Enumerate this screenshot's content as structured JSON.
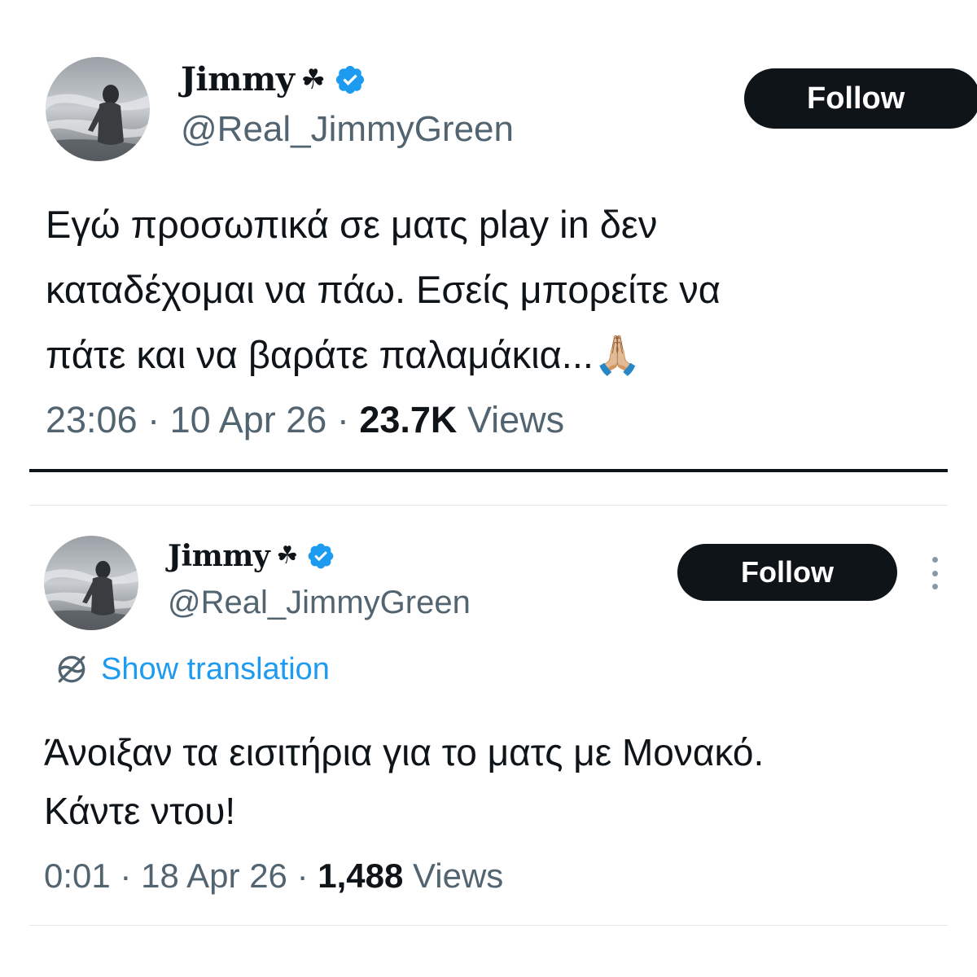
{
  "tweets": [
    {
      "display_name": "Jimmy",
      "name_emoji": "☘",
      "verified": true,
      "handle": "@Real_JimmyGreen",
      "follow_label": "Follow",
      "text": "Εγώ προσωπικά σε ματς play in δεν\nκαταδέχομαι να πάω. Εσείς μπορείτε να\nπάτε και να βαράτε παλαμάκια...🙏🏼",
      "time": "23:06",
      "date": "10 Apr 26",
      "views_count": "23.7K",
      "views_label": "Views"
    },
    {
      "display_name": "Jimmy",
      "name_emoji": "☘",
      "verified": true,
      "handle": "@Real_JimmyGreen",
      "follow_label": "Follow",
      "translate_label": "Show translation",
      "text": "Άνοιξαν τα εισιτήρια για το ματς με Μονακό.\nΚάντε ντου!",
      "time": "0:01",
      "date": "18 Apr 26",
      "views_count": "1,488",
      "views_label": "Views"
    }
  ],
  "separator": "·",
  "colors": {
    "text_primary": "#0f1419",
    "text_secondary": "#536471",
    "link_blue": "#1d9bf0",
    "verified_blue": "#1d9bf0",
    "button_bg": "#0f1419",
    "button_text": "#ffffff"
  },
  "icons": {
    "verified": "verified-badge-icon",
    "translate": "translate-globe-icon",
    "more": "more-options-icon"
  }
}
